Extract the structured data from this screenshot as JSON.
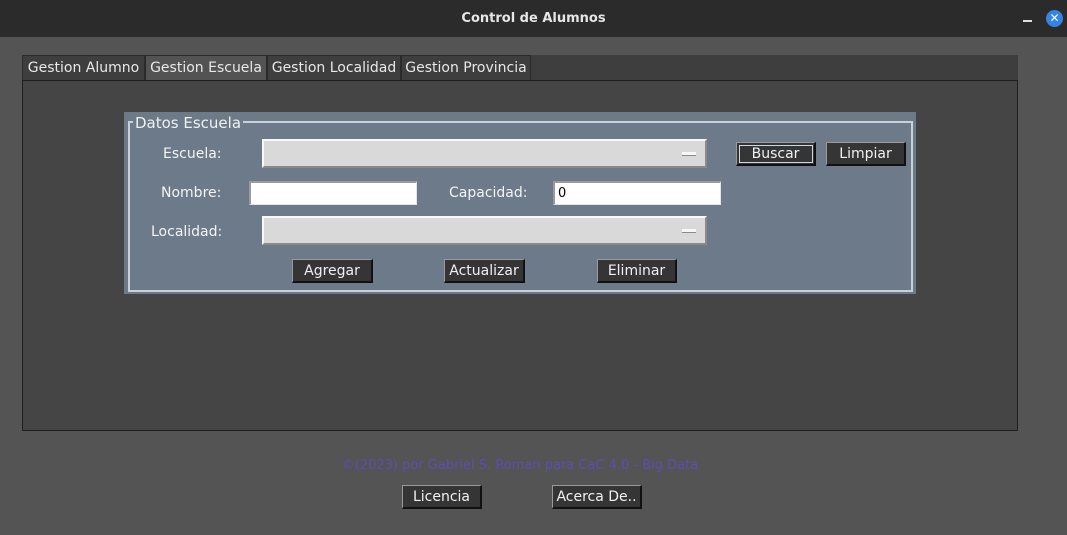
{
  "window": {
    "title": "Control de Alumnos",
    "close_glyph": "✕"
  },
  "tabs": [
    {
      "label": "Gestion Alumno",
      "active": false
    },
    {
      "label": "Gestion Escuela",
      "active": true
    },
    {
      "label": "Gestion Localidad",
      "active": false
    },
    {
      "label": "Gestion Provincia",
      "active": false
    }
  ],
  "form": {
    "frame_title": "Datos Escuela",
    "escuela_label": "Escuela:",
    "escuela_value": "",
    "nombre_label": "Nombre:",
    "nombre_value": "",
    "capacidad_label": "Capacidad:",
    "capacidad_value": "0",
    "localidad_label": "Localidad:",
    "localidad_value": "",
    "buscar_label": "Buscar",
    "limpiar_label": "Limpiar",
    "agregar_label": "Agregar",
    "actualizar_label": "Actualizar",
    "eliminar_label": "Eliminar"
  },
  "footer": {
    "credit": "©(2023) por Gabriel S. Roman para CaC 4.0 - Big Data",
    "licencia_label": "Licencia",
    "acerca_label": "Acerca De.."
  },
  "colors": {
    "frame_bg": "#6c7a8a",
    "credit_text": "#5a4fb0",
    "close_button": "#3584e4"
  }
}
